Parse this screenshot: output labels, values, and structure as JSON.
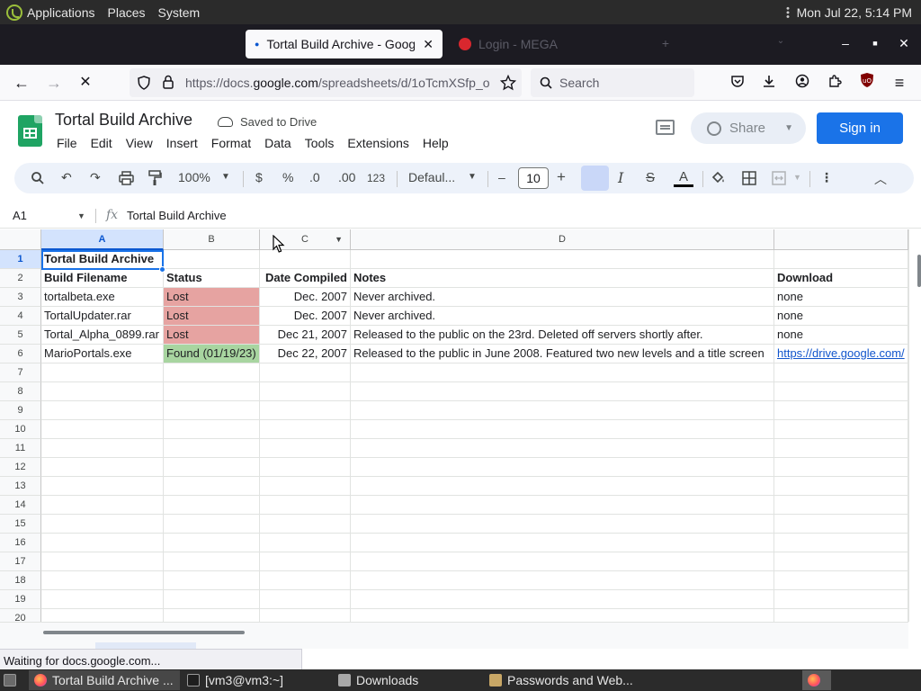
{
  "topbar": {
    "menus": [
      "Applications",
      "Places",
      "System"
    ],
    "clock": "Mon Jul 22,  5:14 PM"
  },
  "tabs": [
    {
      "label": "Tortal Build Archive - Google",
      "state": "active"
    },
    {
      "label": "Login - MEGA",
      "state": "dim"
    }
  ],
  "navbar": {
    "url_prefix": "https://docs.",
    "url_domain": "google.com",
    "url_rest": "/spreadsheets/d/1oTcmXSfp_o",
    "search_placeholder": "Search"
  },
  "sheet_header": {
    "title": "Tortal Build Archive",
    "save_status": "Saved to Drive",
    "menus": [
      "File",
      "Edit",
      "View",
      "Insert",
      "Format",
      "Data",
      "Tools",
      "Extensions",
      "Help"
    ],
    "share_label": "Share",
    "signin_label": "Sign in"
  },
  "toolbar": {
    "zoom": "100%",
    "currency": "$",
    "percent": "%",
    "dec_decrease": ".0",
    "dec_increase": ".00",
    "number_format": "123",
    "font": "Defaul...",
    "font_size": "10"
  },
  "formula_bar": {
    "cell_ref": "A1",
    "fx": "fx",
    "value": "Tortal Build Archive"
  },
  "columns": [
    "A",
    "B",
    "C",
    "D"
  ],
  "row_numbers": [
    "1",
    "2",
    "3",
    "4",
    "5",
    "6",
    "7",
    "8",
    "9",
    "10",
    "11",
    "12",
    "13",
    "14",
    "15",
    "16",
    "17",
    "18",
    "19",
    "20"
  ],
  "rows": [
    {
      "a": "Tortal Build Archive",
      "b": "",
      "c": "",
      "d": "",
      "e": ""
    },
    {
      "a": "Build Filename",
      "b": "Status",
      "c": "Date Compiled",
      "d": "Notes",
      "e": "Download"
    },
    {
      "a": "tortalbeta.exe",
      "b": "Lost",
      "c": "Dec. 2007",
      "d": "Never archived.",
      "e": "none"
    },
    {
      "a": "TortalUpdater.rar",
      "b": "Lost",
      "c": "Dec. 2007",
      "d": "Never archived.",
      "e": "none"
    },
    {
      "a": "Tortal_Alpha_0899.rar",
      "b": "Lost",
      "c": "Dec 21, 2007",
      "d": "Released to the public on the 23rd. Deleted off servers shortly after.",
      "e": "none"
    },
    {
      "a": "MarioPortals.exe",
      "b": "Found (01/19/23)",
      "c": "Dec 22, 2007",
      "d": "Released to the public in June 2008. Featured two new levels and a title screen",
      "e": "https://drive.google.com/"
    }
  ],
  "status_colors": {
    "lost": "#e6a3a1",
    "found": "#a8d5a0",
    "accent": "#1a73e8"
  },
  "statusbar": "Waiting for docs.google.com...",
  "taskbar": [
    {
      "label": "Tortal Build Archive ...",
      "icon": "firefox-icon"
    },
    {
      "label": "[vm3@vm3:~]",
      "icon": "terminal-icon"
    },
    {
      "label": "Downloads",
      "icon": "folder-icon"
    },
    {
      "label": "Passwords and Web...",
      "icon": "keyring-icon"
    }
  ]
}
